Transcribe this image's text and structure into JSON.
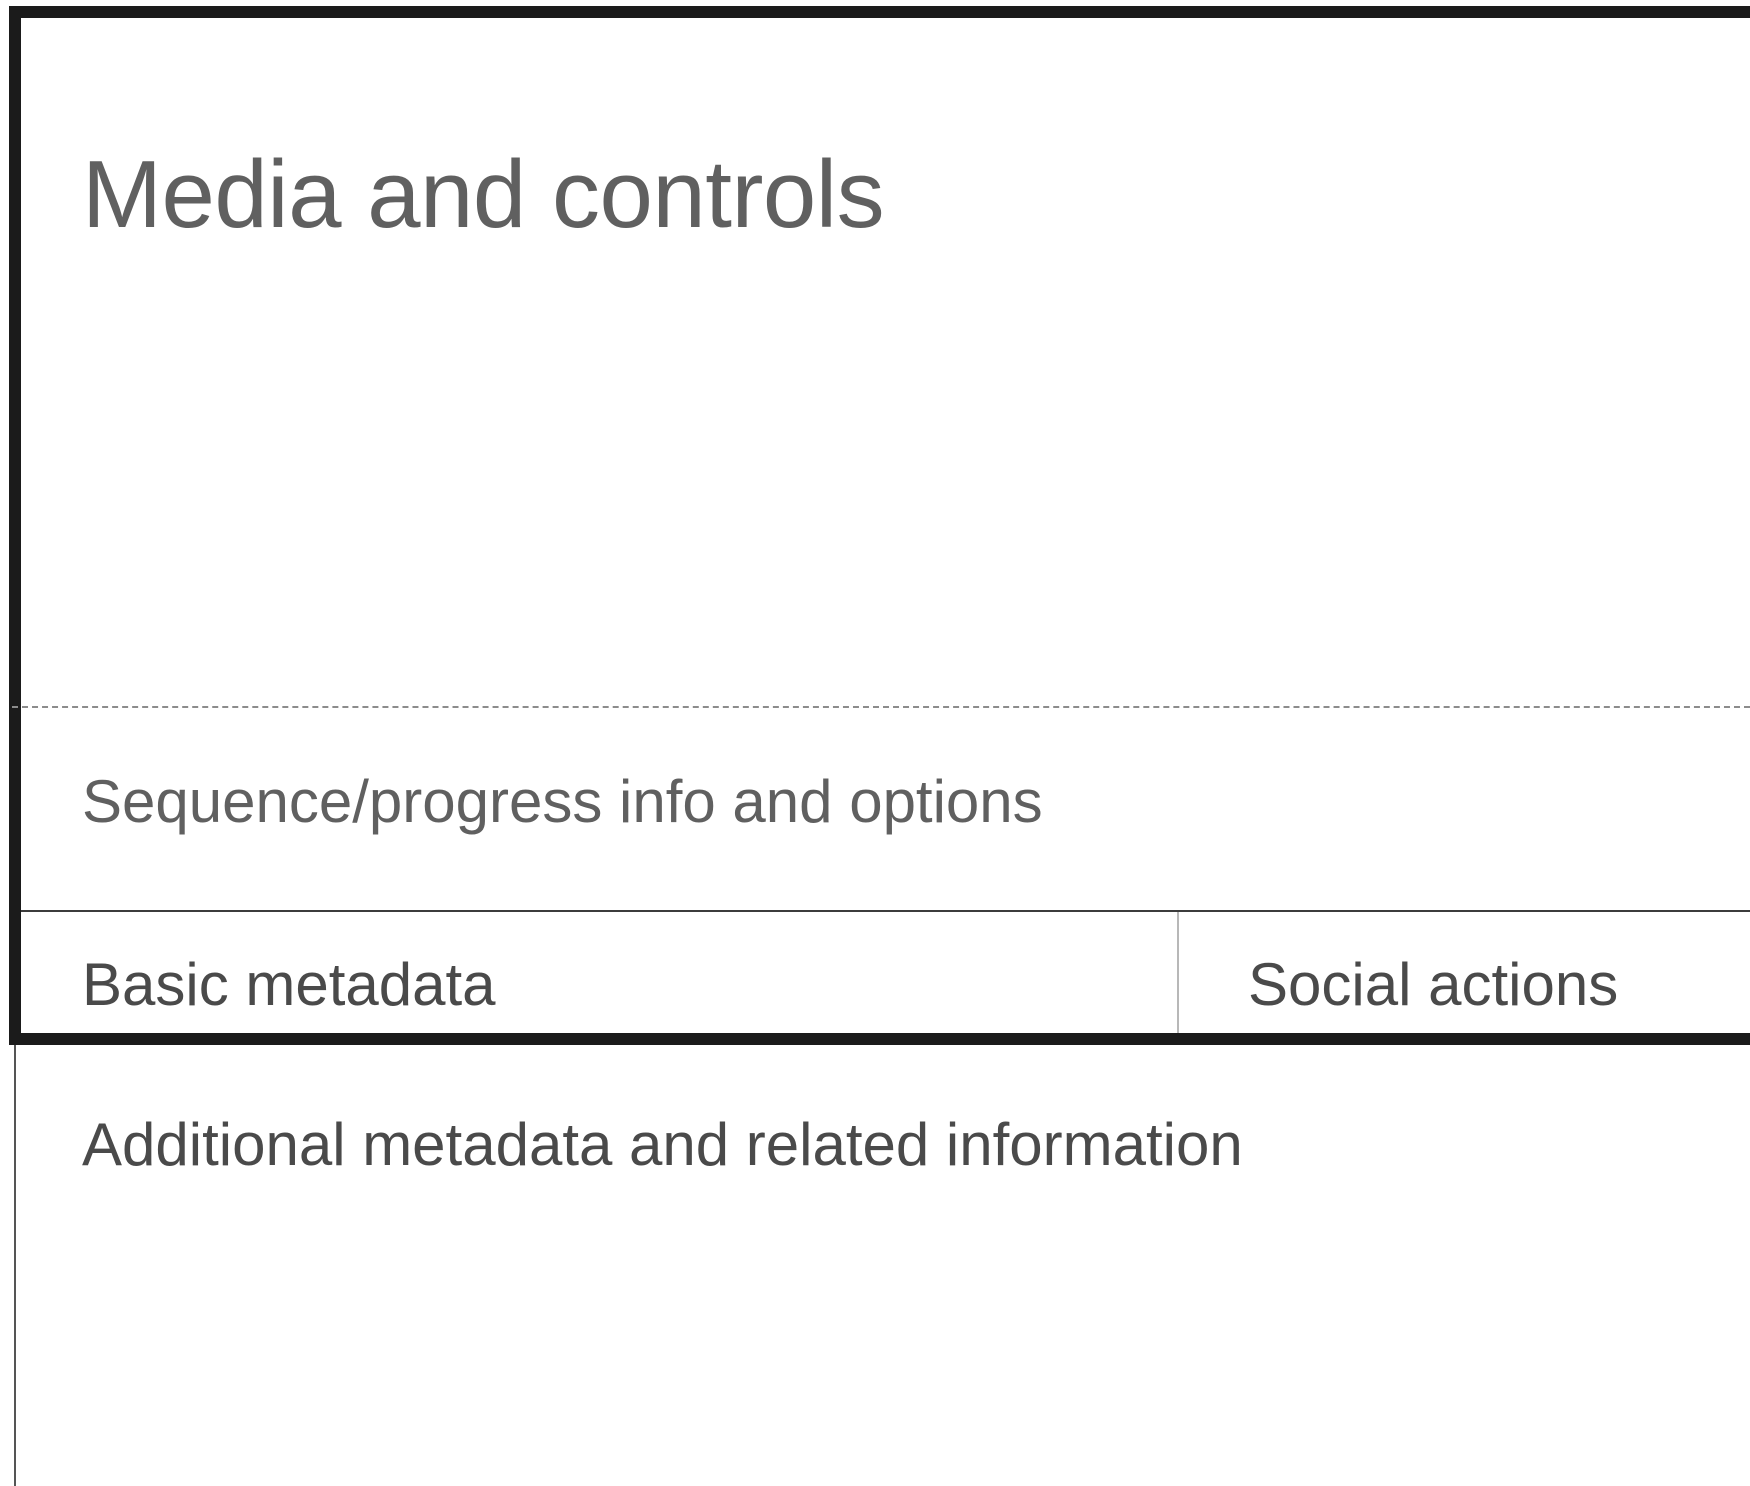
{
  "sections": {
    "media": {
      "label": "Media and controls"
    },
    "sequence": {
      "label": "Sequence/progress info and options"
    },
    "basic_metadata": {
      "label": "Basic metadata"
    },
    "social_actions": {
      "label": "Social actions"
    },
    "additional": {
      "label": "Additional metadata and related information"
    }
  },
  "colors": {
    "border": "#1b1b1b",
    "primary_text": "#606060",
    "secondary_text": "#4a4a4a",
    "dashed_line": "#8c8c8c",
    "divider_light": "#b8b8b8"
  }
}
